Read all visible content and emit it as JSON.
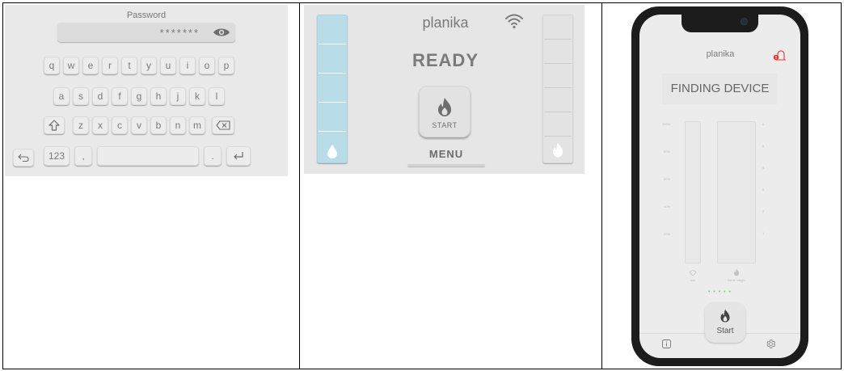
{
  "keyboard": {
    "password_label": "Password",
    "password_value": "*******",
    "row1": [
      "q",
      "w",
      "e",
      "r",
      "t",
      "y",
      "u",
      "i",
      "o",
      "p"
    ],
    "row2": [
      "a",
      "s",
      "d",
      "f",
      "g",
      "h",
      "j",
      "k",
      "l"
    ],
    "row3": [
      "z",
      "x",
      "c",
      "v",
      "b",
      "n",
      "m"
    ],
    "num_key": "123",
    "comma_key": ",",
    "period_key": "."
  },
  "stove": {
    "brand": "planika",
    "status": "READY",
    "start_label": "START",
    "menu_label": "MENU"
  },
  "phone": {
    "brand": "planika",
    "status": "FINDING DEVICE",
    "percent_ticks": [
      "100%",
      "80%",
      "60%",
      "40%",
      "20%"
    ],
    "level_ticks": [
      "6",
      "5",
      "4",
      "3",
      "2",
      "1"
    ],
    "fuel_label": "fuel",
    "flame_label": "flame height",
    "connecting_dots": "• • • • •",
    "start_label": "Start",
    "accent_green": "#73d36b",
    "alert_red": "#e53935"
  },
  "icons": {
    "eye": "eye-icon",
    "shift": "shift-icon",
    "backspace": "backspace-icon",
    "enter": "enter-icon",
    "back": "back-arrow-icon",
    "wifi": "wifi-icon",
    "flame": "flame-icon",
    "drop": "water-drop-icon",
    "bell": "bell-alert-icon",
    "info": "info-icon",
    "settings": "gear-icon"
  }
}
